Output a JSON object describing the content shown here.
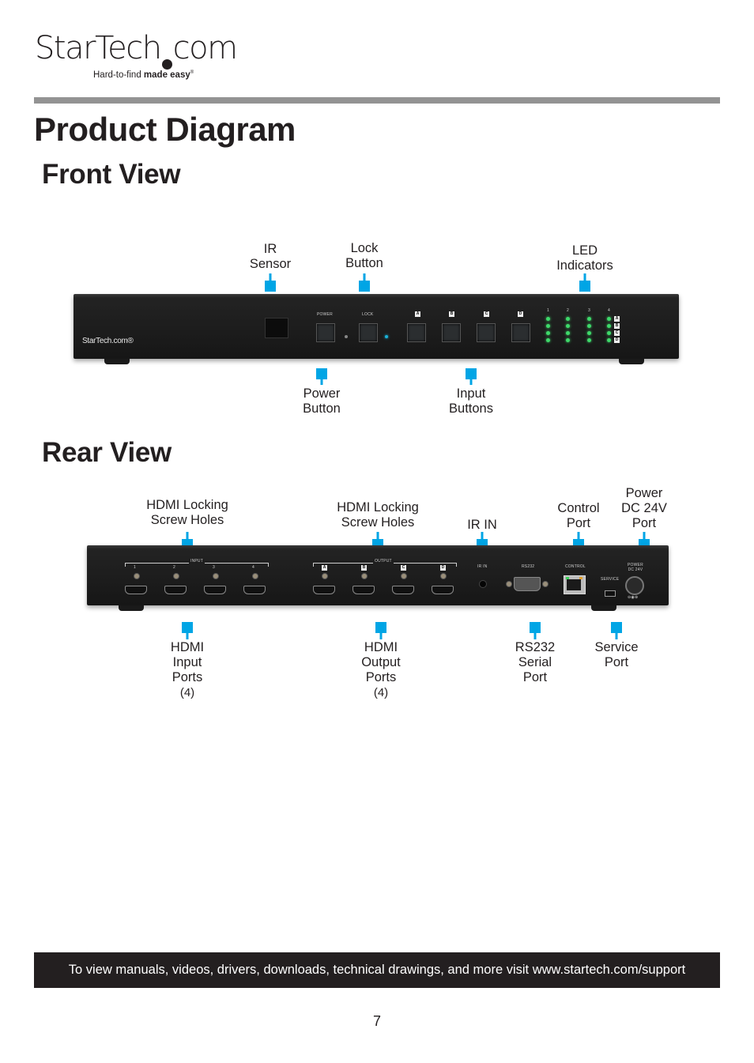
{
  "brand": {
    "logo_text_left": "StarTech",
    "logo_text_right": "com",
    "tagline_light": "Hard-to-find",
    "tagline_bold": "made easy",
    "tagline_mark": "®"
  },
  "page": {
    "title": "Product Diagram",
    "page_number": "7"
  },
  "front_view": {
    "heading": "Front View",
    "device": {
      "logo": "StarTech.com®",
      "button_labels": [
        "POWER",
        "LOCK"
      ],
      "input_buttons": [
        "A",
        "B",
        "C",
        "D"
      ],
      "led_columns": [
        "1",
        "2",
        "3",
        "4"
      ],
      "led_rows": [
        "A",
        "B",
        "C",
        "D"
      ]
    },
    "callouts_top": [
      {
        "id": "ir-sensor",
        "lines": [
          "IR",
          "Sensor"
        ]
      },
      {
        "id": "lock-button",
        "lines": [
          "Lock",
          "Button"
        ]
      },
      {
        "id": "led-indicators",
        "lines": [
          "LED",
          "Indicators"
        ]
      }
    ],
    "callouts_bottom": [
      {
        "id": "power-button",
        "lines": [
          "Power",
          "Button"
        ]
      },
      {
        "id": "input-buttons",
        "lines": [
          "Input",
          "Buttons"
        ]
      }
    ]
  },
  "rear_view": {
    "heading": "Rear View",
    "device": {
      "input_group_label": "INPUT",
      "output_group_label": "OUTPUT",
      "input_ports": [
        "1",
        "2",
        "3",
        "4"
      ],
      "output_ports": [
        "A",
        "B",
        "C",
        "D"
      ],
      "ir_label": "IR IN",
      "rs232_label": "RS232",
      "control_label": "CONTROL",
      "service_label": "SERVICE",
      "power_label_1": "POWER",
      "power_label_2": "DC 24V"
    },
    "callouts_top": [
      {
        "id": "hdmi-locking-screw-holes-input",
        "lines": [
          "HDMI Locking",
          "Screw Holes"
        ]
      },
      {
        "id": "hdmi-locking-screw-holes-output",
        "lines": [
          "HDMI Locking",
          "Screw Holes"
        ]
      },
      {
        "id": "ir-in",
        "lines": [
          "IR IN"
        ]
      },
      {
        "id": "control-port",
        "lines": [
          "Control",
          "Port"
        ]
      },
      {
        "id": "power-port",
        "lines": [
          "Power",
          "DC 24V",
          "Port"
        ]
      }
    ],
    "callouts_bottom": [
      {
        "id": "hdmi-input-ports",
        "lines": [
          "HDMI",
          "Input",
          "Ports"
        ],
        "count": "(4)"
      },
      {
        "id": "hdmi-output-ports",
        "lines": [
          "HDMI",
          "Output",
          "Ports"
        ],
        "count": "(4)"
      },
      {
        "id": "rs232-serial-port",
        "lines": [
          "RS232",
          "Serial",
          "Port"
        ]
      },
      {
        "id": "service-port",
        "lines": [
          "Service",
          "Port"
        ]
      }
    ]
  },
  "footer": {
    "support_text": "To view manuals, videos, drivers, downloads, technical drawings, and more visit www.startech.com/support"
  },
  "colors": {
    "callout_accent": "#00a5e5",
    "led_green": "#3ed96a",
    "rule_gray": "#939393",
    "footer_bg": "#231f20"
  }
}
